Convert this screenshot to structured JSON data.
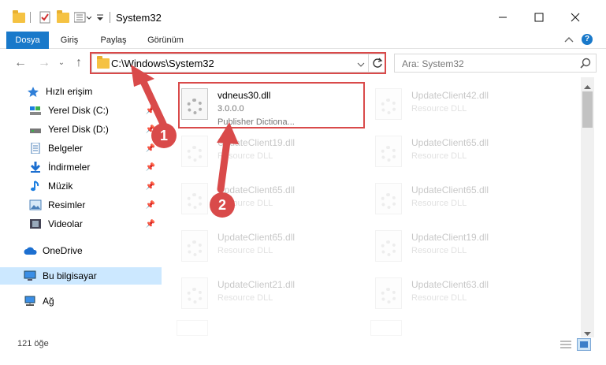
{
  "window": {
    "title": "System32",
    "minimize_icon": "minimize-icon",
    "maximize_icon": "maximize-icon",
    "close_icon": "close-icon"
  },
  "ribbon": {
    "tabs": [
      {
        "label": "Dosya",
        "active": true
      },
      {
        "label": "Giriş",
        "active": false
      },
      {
        "label": "Paylaş",
        "active": false
      },
      {
        "label": "Görünüm",
        "active": false
      }
    ],
    "help": "?"
  },
  "address": {
    "path": "C:\\Windows\\System32",
    "search_placeholder": "Ara: System32"
  },
  "sidebar": {
    "items": [
      {
        "label": "Hızlı erişim",
        "icon": "star-icon",
        "pinned": false,
        "selected": false
      },
      {
        "label": "Yerel Disk (C:)",
        "icon": "drive-icon",
        "pinned": true,
        "selected": false
      },
      {
        "label": "Yerel Disk (D:)",
        "icon": "drive-icon",
        "pinned": true,
        "selected": false
      },
      {
        "label": "Belgeler",
        "icon": "document-icon",
        "pinned": true,
        "selected": false
      },
      {
        "label": "İndirmeler",
        "icon": "download-icon",
        "pinned": true,
        "selected": false
      },
      {
        "label": "Müzik",
        "icon": "music-icon",
        "pinned": true,
        "selected": false
      },
      {
        "label": "Resimler",
        "icon": "pictures-icon",
        "pinned": true,
        "selected": false
      },
      {
        "label": "Videolar",
        "icon": "video-icon",
        "pinned": true,
        "selected": false
      },
      {
        "label": "OneDrive",
        "icon": "cloud-icon",
        "pinned": false,
        "selected": false
      },
      {
        "label": "Bu bilgisayar",
        "icon": "computer-icon",
        "pinned": false,
        "selected": true
      },
      {
        "label": "Ağ",
        "icon": "network-icon",
        "pinned": false,
        "selected": false
      }
    ]
  },
  "files": [
    {
      "name": "vdneus30.dll",
      "line2": "3.0.0.0",
      "line3": "Publisher   Dictiona...",
      "highlighted": true
    },
    {
      "name": "UpdateClient42.dll",
      "line2": "Resource DLL",
      "line3": ""
    },
    {
      "name": "UpdateClient19.dll",
      "line2": "Resource DLL",
      "line3": ""
    },
    {
      "name": "UpdateClient65.dll",
      "line2": "Resource DLL",
      "line3": ""
    },
    {
      "name": "UpdateClient65.dll",
      "line2": "Resource DLL",
      "line3": ""
    },
    {
      "name": "UpdateClient65.dll",
      "line2": "Resource DLL",
      "line3": ""
    },
    {
      "name": "UpdateClient65.dll",
      "line2": "Resource DLL",
      "line3": ""
    },
    {
      "name": "UpdateClient19.dll",
      "line2": "Resource DLL",
      "line3": ""
    },
    {
      "name": "UpdateClient21.dll",
      "line2": "Resource DLL",
      "line3": ""
    },
    {
      "name": "UpdateClient63.dll",
      "line2": "Resource DLL",
      "line3": ""
    }
  ],
  "status": {
    "count": "121 öğe"
  },
  "annotations": {
    "step1": "1",
    "step2": "2",
    "color": "#d94a4a"
  }
}
